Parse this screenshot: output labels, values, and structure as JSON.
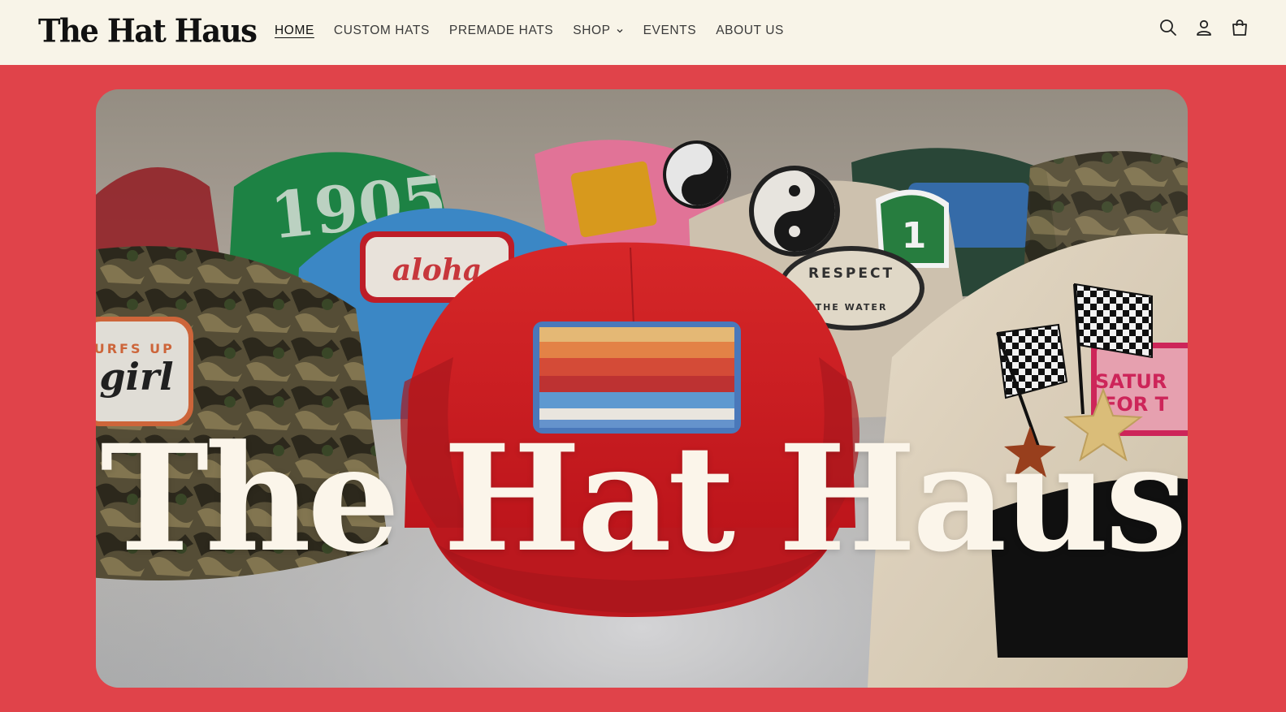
{
  "header": {
    "logo": "The Hat Haus",
    "nav": [
      {
        "label": "HOME",
        "active": true
      },
      {
        "label": "CUSTOM HATS"
      },
      {
        "label": "PREMADE HATS"
      },
      {
        "label": "SHOP",
        "has_dropdown": true
      },
      {
        "label": "EVENTS"
      },
      {
        "label": "ABOUT US"
      }
    ],
    "icons": [
      "search-icon",
      "account-icon",
      "cart-icon"
    ]
  },
  "hero": {
    "title": "The Hat Haus",
    "patch_texts": {
      "aloha": "aloha",
      "number": "1905",
      "surfs_up": "SURFS UP",
      "girl": "girl",
      "respect": "RESPECT",
      "the_water": "THE WATER",
      "saturday": "SATUR",
      "for": "FOR T",
      "route": "1"
    }
  },
  "colors": {
    "page_background": "#e0434a",
    "header_background": "#f8f4e8",
    "hero_title": "#fbf5ea"
  }
}
